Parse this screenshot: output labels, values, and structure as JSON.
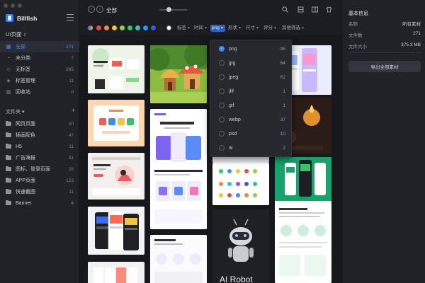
{
  "app": {
    "name": "Billfish"
  },
  "workspace": {
    "label": "UI页面",
    "caret": "⇕"
  },
  "nav": [
    {
      "label": "全部",
      "count": "271",
      "icon": "grid-icon",
      "active": true
    },
    {
      "label": "未分类",
      "count": "7",
      "icon": "pie-icon"
    },
    {
      "label": "无标签",
      "count": "265",
      "icon": "tag-icon"
    },
    {
      "label": "标签管理",
      "count": "11",
      "icon": "tag-manage-icon"
    },
    {
      "label": "回收站",
      "count": "0",
      "icon": "trash-icon"
    }
  ],
  "folders_header": {
    "label": "文件夹",
    "caret": "▾",
    "add": "+"
  },
  "folders": [
    {
      "label": "网页页面",
      "count": "20"
    },
    {
      "label": "插画配色",
      "count": "47"
    },
    {
      "label": "H5",
      "count": "11"
    },
    {
      "label": "广告海报",
      "count": "31"
    },
    {
      "label": "图标、登录页面",
      "count": "28"
    },
    {
      "label": "APP页面",
      "count": "123"
    },
    {
      "label": "快速截图",
      "count": "11"
    },
    {
      "label": "Banner",
      "count": "4"
    }
  ],
  "toolbar": {
    "title": "全部",
    "back": "‹",
    "forward": "›"
  },
  "toolbar_icons": [
    "search-icon",
    "filter-icon",
    "layout-icon",
    "shirt-icon"
  ],
  "colors": [
    "#e04b4b",
    "#f08a3c",
    "#f2c43a",
    "#8bd14b",
    "#37c36a",
    "#31c2c8",
    "#3b8ef0",
    "#3a5be0",
    "#222325",
    "#ffffff"
  ],
  "filters": [
    {
      "label": "标签"
    },
    {
      "label": "时间"
    },
    {
      "label": "png",
      "on": true
    },
    {
      "label": "形状"
    },
    {
      "label": "尺寸"
    },
    {
      "label": "评分"
    },
    {
      "label": "其他筛选"
    }
  ],
  "dropdown": [
    {
      "label": "png",
      "count": "95",
      "checked": true
    },
    {
      "label": "jpg",
      "count": "64"
    },
    {
      "label": "jpeg",
      "count": "62"
    },
    {
      "label": "jfif",
      "count": "1"
    },
    {
      "label": "gif",
      "count": "1"
    },
    {
      "label": "webp",
      "count": "37"
    },
    {
      "label": "psd",
      "count": "10"
    },
    {
      "label": "ai",
      "count": "2"
    }
  ],
  "thumbs": {
    "robot_caption": "AI Robot"
  },
  "panel": {
    "title": "基本信息",
    "rows": [
      {
        "k": "名称",
        "v": "所有素材"
      },
      {
        "k": "文件数",
        "v": "271"
      },
      {
        "k": "文件大小",
        "v": "375.3 MB"
      }
    ],
    "button": "导出全部素材"
  }
}
